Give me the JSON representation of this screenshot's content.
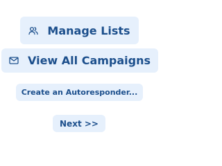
{
  "buttons": {
    "manage_lists": {
      "label": "Manage Lists",
      "icon": "users-icon"
    },
    "view_all_campaigns": {
      "label": "View All Campaigns",
      "icon": "envelope-icon"
    },
    "create_autoresponder": {
      "label": "Create an Autoresponder..."
    },
    "next": {
      "label": "Next >>"
    }
  },
  "colors": {
    "button_background": "#e6f0fc",
    "button_text": "#1c4f8c"
  }
}
